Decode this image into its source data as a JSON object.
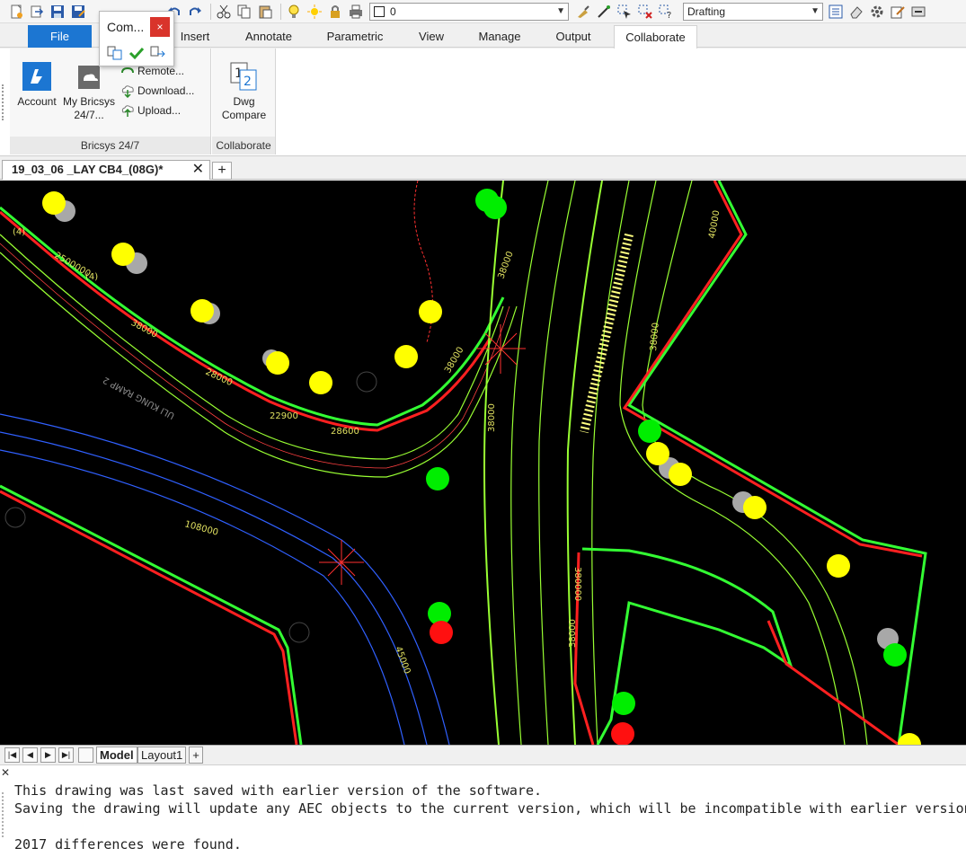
{
  "toolbar": {
    "layer_value": "0",
    "workspace_value": "Drafting",
    "icons": [
      "new-icon",
      "open-icon",
      "save-icon",
      "save-as-icon",
      "cut-icon",
      "copy-icon",
      "paste-icon",
      "undo-icon",
      "redo-icon",
      "layer-bulb-icon",
      "layer-sun-icon",
      "layer-lock-icon",
      "layer-print-icon"
    ]
  },
  "ribbon": {
    "tabs": [
      "File",
      "Insert",
      "Annotate",
      "Parametric",
      "View",
      "Manage",
      "Output",
      "Collaborate"
    ],
    "active_tab": "Collaborate",
    "groups": {
      "bricsys": {
        "label": "Bricsys 24/7",
        "account": "Account",
        "my_bricsys_line1": "My Bricsys",
        "my_bricsys_line2": "24/7...",
        "remote": "Remote...",
        "download": "Download...",
        "upload": "Upload..."
      },
      "collaborate": {
        "label": "Collaborate",
        "dwg_compare_line1": "Dwg",
        "dwg_compare_line2": "Compare"
      }
    },
    "accent_color": "#1c76d2"
  },
  "popup": {
    "title": "Com...",
    "close": "×"
  },
  "document": {
    "tab_title": "19_03_06 _LAY CB4_(08G)*",
    "close": "✕",
    "add": "+"
  },
  "drawing": {
    "labels": {
      "l1": "(4)",
      "l2": "2500000",
      "l3": "(4)",
      "l4": "38000",
      "l5": "28000",
      "l6": "22900",
      "l7": "28600",
      "l8": "ULI KUNG RAMP 2",
      "l9": "38000",
      "l10": "38000",
      "l11": "38000",
      "l12": "40000",
      "l13": "38000",
      "l14": "38000",
      "l15": "380000",
      "l16": "45000",
      "l17": "108000"
    },
    "colors": {
      "background": "#000000",
      "boundary_green": "#33ff33",
      "boundary_red": "#ff2020",
      "lane": "#99ff33",
      "yellow": "#ffff00",
      "grey": "#a0a0a0"
    }
  },
  "layout": {
    "nav": [
      "|◀",
      "◀",
      "▶",
      "▶|"
    ],
    "tabs": [
      "Model",
      "Layout1"
    ],
    "active": "Model",
    "add": "+"
  },
  "command": {
    "close": "✕",
    "lines": [
      "This drawing was last saved with earlier version of the software.",
      "Saving the drawing will update any AEC objects to the current version, which will be incompatible with earlier versions",
      "",
      "2017 differences were found."
    ]
  }
}
